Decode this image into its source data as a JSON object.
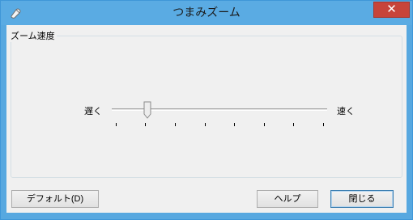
{
  "window": {
    "title": "つまみズーム",
    "close_glyph": "✕"
  },
  "group": {
    "label": "ズーム速度"
  },
  "slider": {
    "min_label": "遅く",
    "max_label": "速く",
    "tick_count": 8,
    "value_fraction": 0.14
  },
  "buttons": {
    "default_label": "デフォルト(D)",
    "help_label": "ヘルプ",
    "close_label": "閉じる"
  }
}
